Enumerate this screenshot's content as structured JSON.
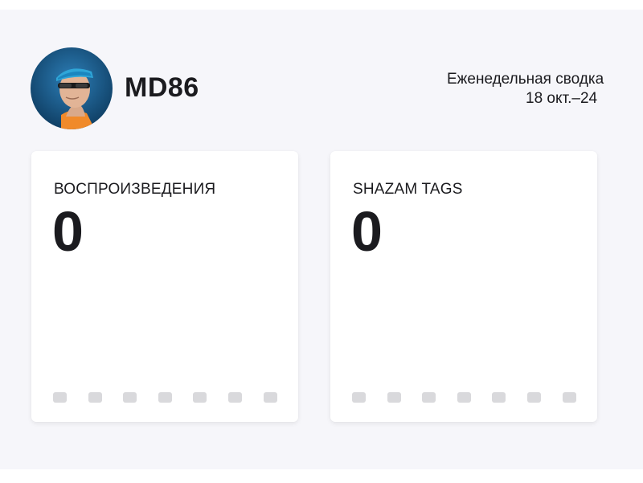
{
  "profile": {
    "username": "MD86",
    "avatar_icon": "user-avatar"
  },
  "summary": {
    "title": "Еженедельная сводка",
    "range": "18 окт.–24"
  },
  "cards": [
    {
      "label": "ВОСПРОИЗВЕДЕНИЯ",
      "value": "0",
      "daily_values": [
        0,
        0,
        0,
        0,
        0,
        0,
        0
      ]
    },
    {
      "label": "SHAZAM TAGS",
      "value": "0",
      "daily_values": [
        0,
        0,
        0,
        0,
        0,
        0,
        0
      ]
    }
  ],
  "colors": {
    "background": "#f6f6fa",
    "card": "#ffffff",
    "text": "#1b1b1f",
    "empty_bar": "#d9d9dc"
  }
}
